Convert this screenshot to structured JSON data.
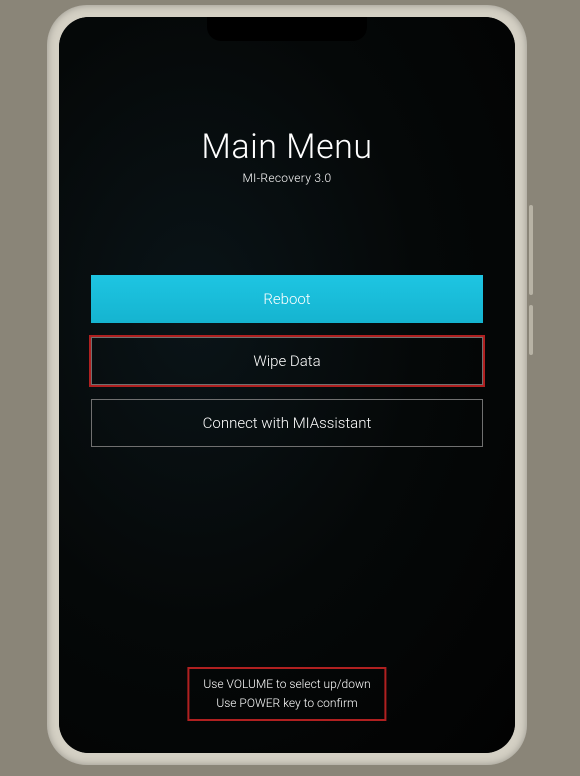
{
  "header": {
    "title": "Main Menu",
    "subtitle": "MI-Recovery 3.0"
  },
  "menu": {
    "items": [
      {
        "label": "Reboot",
        "selected": true,
        "highlighted": false
      },
      {
        "label": "Wipe Data",
        "selected": false,
        "highlighted": true
      },
      {
        "label": "Connect with MIAssistant",
        "selected": false,
        "highlighted": false
      }
    ]
  },
  "footer": {
    "line1": "Use VOLUME to select up/down",
    "line2": "Use POWER key to confirm"
  },
  "colors": {
    "selected_bg": "#1ec5e2",
    "highlight_border": "#b02020",
    "text": "#ffffff"
  }
}
